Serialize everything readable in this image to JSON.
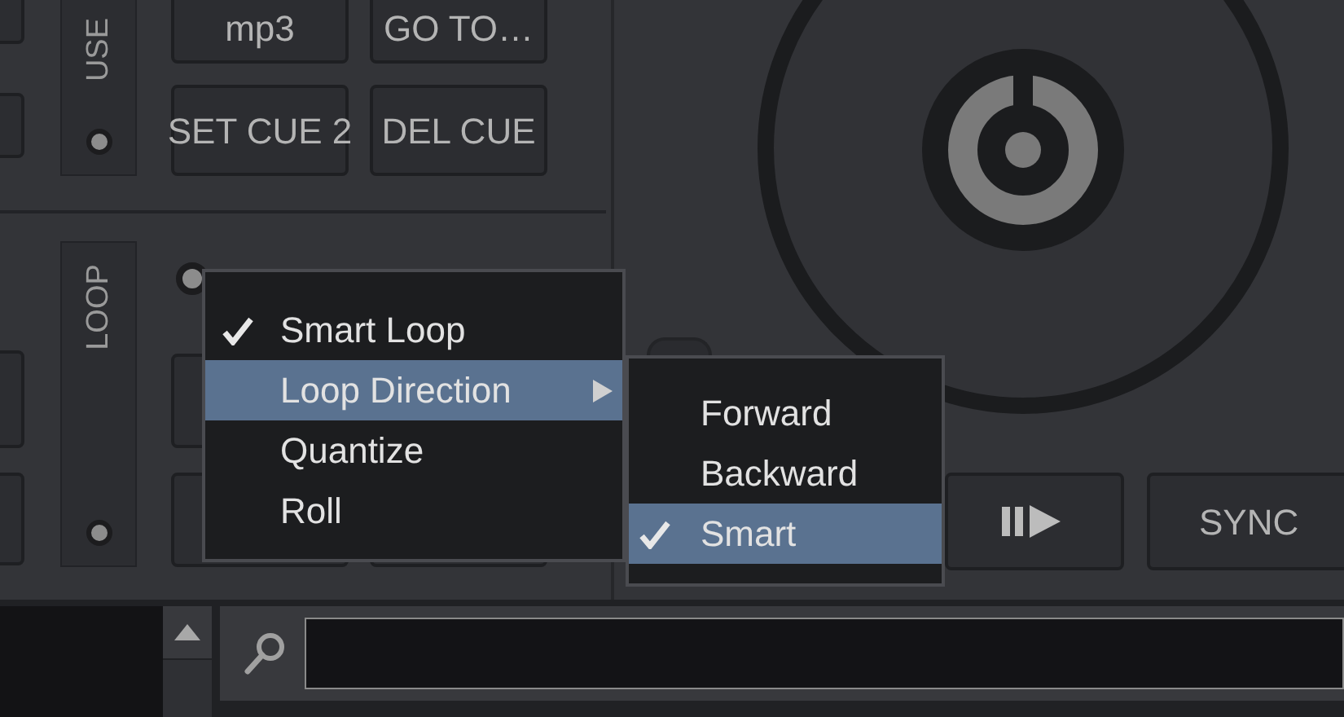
{
  "panels": [
    {
      "label": "USE"
    },
    {
      "label": "LOOP"
    }
  ],
  "buttons": [
    {
      "label": "mp3"
    },
    {
      "label": "GO TO…"
    },
    {
      "label": "SET CUE 2"
    },
    {
      "label": "DEL CUE"
    }
  ],
  "menu": {
    "items": [
      {
        "label": "Smart Loop",
        "checked": true,
        "selected": false,
        "submenu": false
      },
      {
        "label": "Loop Direction",
        "checked": false,
        "selected": true,
        "submenu": true
      },
      {
        "label": "Quantize",
        "checked": false,
        "selected": false,
        "submenu": false
      },
      {
        "label": "Roll",
        "checked": false,
        "selected": false,
        "submenu": false
      }
    ]
  },
  "submenu": {
    "items": [
      {
        "label": "Forward",
        "checked": false,
        "selected": false
      },
      {
        "label": "Backward",
        "checked": false,
        "selected": false
      },
      {
        "label": "Smart",
        "checked": true,
        "selected": true
      }
    ]
  },
  "transport": {
    "sync": "SYNC"
  }
}
